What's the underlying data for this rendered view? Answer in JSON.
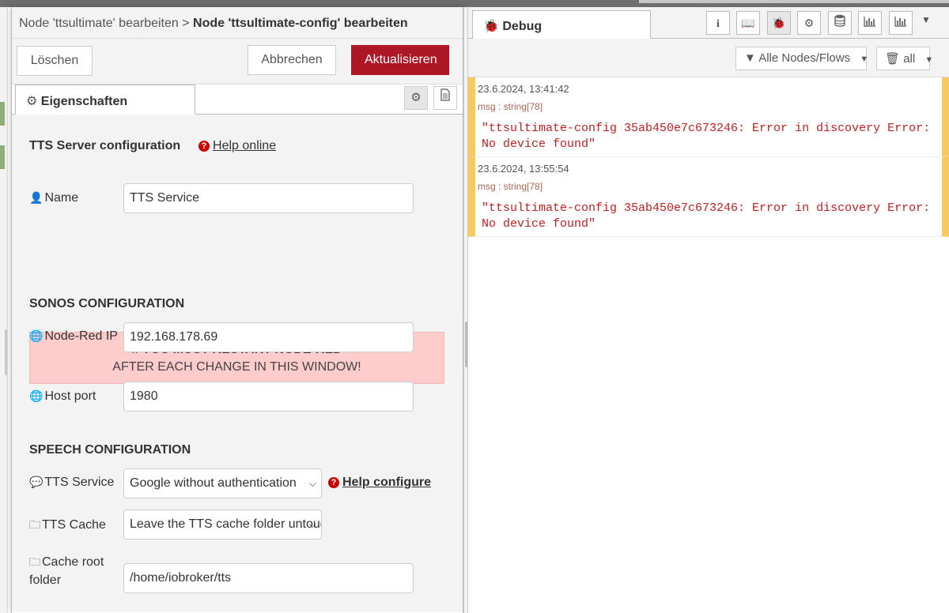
{
  "editor": {
    "breadcrumb_parent": "Node 'ttsultimate' bearbeiten",
    "breadcrumb_sep": ">",
    "breadcrumb_current": "Node 'ttsultimate-config' bearbeiten",
    "delete_label": "Löschen",
    "cancel_label": "Abbrechen",
    "update_label": "Aktualisieren",
    "tab_label": "Eigenschaften"
  },
  "form": {
    "server_title": "TTS Server configuration",
    "help_online": "Help online",
    "name_label": "Name",
    "name_value": "TTS Service",
    "warning_prefix": "If",
    "warning_bold": "YOU MUST RESTART NODE-RED",
    "warning_line2": "AFTER EACH CHANGE IN THIS WINDOW!",
    "sonos_title": "SONOS CONFIGURATION",
    "nodered_ip_label": "Node-Red IP",
    "nodered_ip_value": "192.168.178.69",
    "host_port_label": "Host port",
    "host_port_value": "1980",
    "speech_title": "SPEECH CONFIGURATION",
    "tts_service_label": "TTS Service",
    "tts_service_value": "Google without authentication",
    "help_configure": "Help configure",
    "tts_cache_label": "TTS Cache",
    "tts_cache_value": "Leave the TTS cache folder untouched",
    "cache_root_label_1": "Cache root",
    "cache_root_label_2": "folder",
    "cache_root_value": "/home/iobroker/tts"
  },
  "debug": {
    "tab_label": "Debug",
    "filter_label": "Alle Nodes/Flows",
    "clear_label": "all",
    "messages": [
      {
        "timestamp": "23.6.2024, 13:41:42",
        "type": "msg : string[78]",
        "line1": "\"ttsultimate-config 35ab450e7c673246: Error in discovery Error:",
        "line2": "No device found\""
      },
      {
        "timestamp": "23.6.2024, 13:55:54",
        "type": "msg : string[78]",
        "line1": "\"ttsultimate-config 35ab450e7c673246: Error in discovery Error:",
        "line2": "No device found\""
      }
    ]
  },
  "colors": {
    "primary": "#ad1625",
    "warning_bg": "#ffcccc",
    "debug_marker": "#f8c95c",
    "error_text": "#c02020"
  },
  "icons": {
    "sidebar_buttons": [
      "info-icon",
      "book-icon",
      "bug-icon",
      "gear-icon",
      "database-icon",
      "bar-chart-icon",
      "bar-chart-icon"
    ]
  }
}
